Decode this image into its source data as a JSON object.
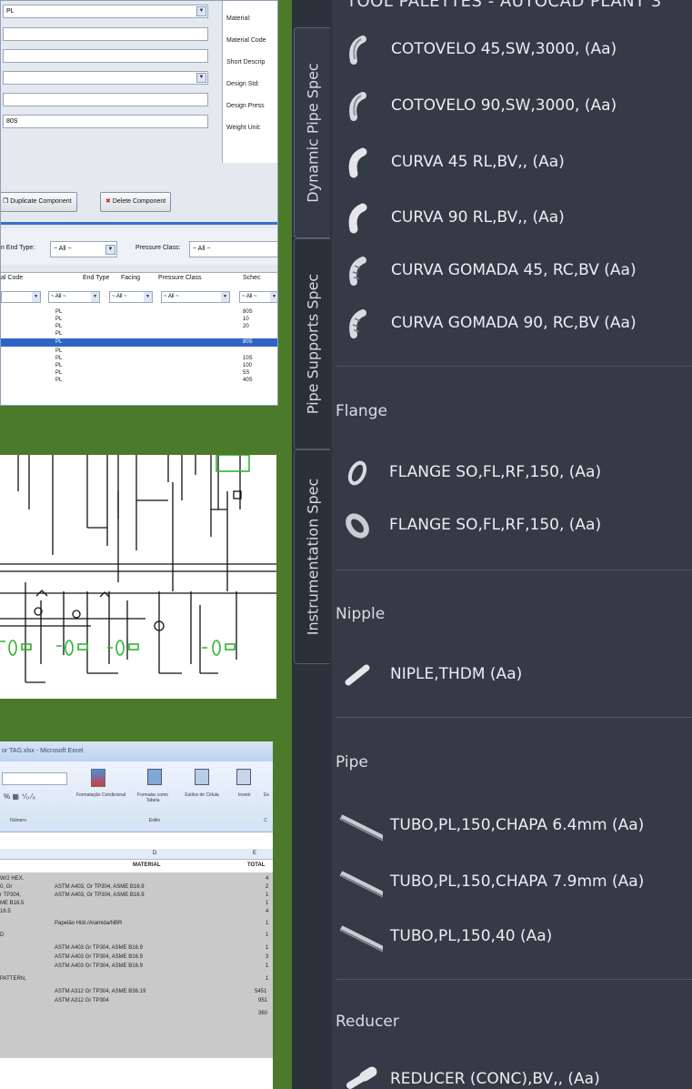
{
  "spec_editor": {
    "fields": [
      "PL",
      "",
      "",
      "",
      "",
      "80S"
    ],
    "property_labels": [
      "Material:",
      "Material Code",
      "Short Descrip",
      "Design Std:",
      "Design Press",
      "Weight Unit:"
    ],
    "duplicate_button": "Duplicate Component",
    "delete_button": "Delete Component",
    "filter_end_label": "n End Type:",
    "filter_end_value": "~ All ~",
    "filter_pressure_label": "Pressure Class:",
    "filter_pressure_value": "~ All ~",
    "columns": [
      "al Code",
      "End Type",
      "Facing",
      "Pressure Class",
      "Schec"
    ],
    "column_filters": [
      "",
      "~ All ~",
      "~ All ~",
      "~ All ~",
      "~ All ~"
    ],
    "rows": [
      {
        "end": "PL",
        "sched": "80S"
      },
      {
        "end": "PL",
        "sched": "10"
      },
      {
        "end": "PL",
        "sched": "20"
      },
      {
        "end": "PL",
        "sched": ""
      },
      {
        "end": "PL",
        "sched": "80S"
      },
      {
        "end": "PL",
        "sched": ""
      },
      {
        "end": "PL",
        "sched": "10S"
      },
      {
        "end": "PL",
        "sched": "100"
      },
      {
        "end": "PL",
        "sched": "5S"
      },
      {
        "end": "PL",
        "sched": "40S"
      }
    ]
  },
  "excel": {
    "title": "or TAG.xlsx - Microsoft Excel",
    "ribbon_buttons": [
      "Formatação Condicional",
      "Formatar como Tabela",
      "Estilos de Célula",
      "Inserir",
      "Ex"
    ],
    "ribbon_groups": [
      "Número",
      "Estilo",
      "C"
    ],
    "col_d": "D",
    "col_e": "E",
    "header_material": "MATERIAL",
    "header_total": "TOTAL",
    "rows": [
      {
        "a": "W/2 HEX.",
        "m": "",
        "t": "4"
      },
      {
        "a": "0, Gr",
        "m": "ASTM A403, Gr TP304, ASME B16.9",
        "t": "2"
      },
      {
        "a": "r TP304,",
        "m": "ASTM A403, Gr TP304, ASME B16.9",
        "t": "1"
      },
      {
        "a": "ME B16.5",
        "m": "",
        "t": "1"
      },
      {
        "a": "16.5",
        "m": "",
        "t": "4"
      },
      {
        "a": "",
        "m": "Papelão Hidr./Aramida/NBR",
        "t": "1"
      },
      {
        "a": "D",
        "m": "",
        "t": "1"
      },
      {
        "a": "",
        "m": "ASTM A403 Gr TP304, ASME B16.9",
        "t": "1"
      },
      {
        "a": "",
        "m": "ASTM A403 Gr TP304, ASME B16.9",
        "t": "3"
      },
      {
        "a": "",
        "m": "ASTM A403 Gr TP304, ASME B16.9",
        "t": "1"
      },
      {
        "a": "PATTERN,",
        "m": "",
        "t": "1"
      },
      {
        "a": "",
        "m": "ASTM A312 Gr TP304, ASME B36.19",
        "t": "5451"
      },
      {
        "a": "",
        "m": "ASTM A312 Gr TP304",
        "t": "951"
      },
      {
        "a": "",
        "m": "",
        "t": "360"
      }
    ]
  },
  "palette": {
    "title": "TOOL PALETTES - AUTOCAD PLANT 3",
    "tabs": [
      "Dynamic Pipe Spec",
      "Pipe Supports Spec",
      "Instrumentation Spec"
    ],
    "fittings": [
      "COTOVELO 45,SW,3000, (Aa)",
      "COTOVELO 90,SW,3000, (Aa)",
      "CURVA 45 RL,BV,, (Aa)",
      "CURVA 90 RL,BV,, (Aa)",
      "CURVA GOMADA 45, RC,BV (Aa)",
      "CURVA GOMADA 90, RC,BV (Aa)"
    ],
    "flange_label": "Flange",
    "flanges": [
      "FLANGE SO,FL,RF,150, (Aa)",
      "FLANGE SO,FL,RF,150, (Aa)"
    ],
    "nipple_label": "Nipple",
    "nipples": [
      "NIPLE,THDM (Aa)"
    ],
    "pipe_label": "Pipe",
    "pipes": [
      "TUBO,PL,150,CHAPA 6.4mm (Aa)",
      "TUBO,PL,150,CHAPA 7.9mm (Aa)",
      "TUBO,PL,150,40 (Aa)"
    ],
    "reducer_label": "Reducer",
    "reducers": [
      "REDUCER (CONC),BV,, (Aa)"
    ]
  },
  "colors": {
    "background": "#4b7a2a",
    "palette_bg": "#343a46",
    "selection": "#2f64c6"
  },
  "icons": [
    "elbow-icon",
    "flange-icon",
    "nipple-icon",
    "pipe-icon",
    "reducer-icon",
    "dropdown-arrow-icon",
    "duplicate-icon",
    "delete-icon"
  ]
}
